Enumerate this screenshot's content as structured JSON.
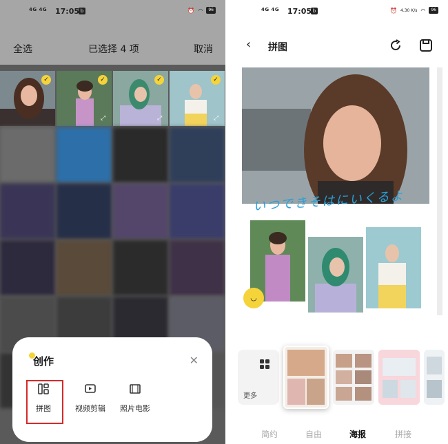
{
  "status_left": {
    "signal": "4G 4G",
    "time": "17:05",
    "battery": "96"
  },
  "status_right": {
    "signal": "4G 4G",
    "time": "17:05",
    "battery": "96",
    "speed": "4.30 K/s"
  },
  "left_screen": {
    "select_all": "全选",
    "selected_count": "已选择 4 项",
    "cancel": "取消",
    "sheet": {
      "title": "创作",
      "tools": [
        {
          "label": "拼图",
          "icon": "collage-icon"
        },
        {
          "label": "视频剪辑",
          "icon": "video-edit-icon"
        },
        {
          "label": "照片电影",
          "icon": "photo-movie-icon"
        }
      ]
    }
  },
  "right_screen": {
    "title": "拼图",
    "poster_script_text": "いつできそはにいくるよ",
    "more_label": "更多",
    "tabs": [
      "简约",
      "自由",
      "海报",
      "拼接"
    ],
    "active_tab": "海报"
  },
  "colors": {
    "accent_yellow": "#f5d33b",
    "highlight_red": "#d42a2a",
    "script_blue": "#2a9fd6"
  }
}
